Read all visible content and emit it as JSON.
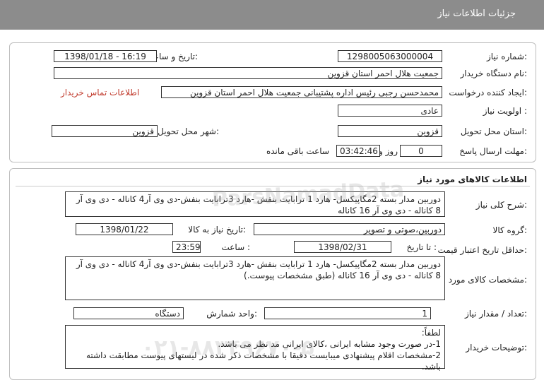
{
  "header": {
    "title": "جزئیات اطلاعات نیاز"
  },
  "general": {
    "need_number_label": "شماره نیاز:",
    "need_number": "1298005063000004",
    "announce_label": "تاریخ و ساعت اعلان عمومی:",
    "announce_value": "1398/01/18 - 16:19",
    "buyer_org_label": "نام دستگاه خریدار:",
    "buyer_org": "جمعیت هلال احمر استان قزوین",
    "requester_label": "ایجاد کننده درخواست:",
    "requester": "محمدحسن رجبی رئیس اداره پشتیبانی جمعیت هلال احمر استان قزوین",
    "contact_link": "اطلاعات تماس خریدار",
    "priority_label": "اولویت نیاز :",
    "priority": "عادی",
    "province_label": "استان محل تحویل:",
    "province": "قزوین",
    "city_label": "شهر محل تحویل:",
    "city": "قزوین",
    "deadline_label": "مهلت ارسال پاسخ:",
    "days": "0",
    "days_unit": "روز و",
    "time_left": "03:42:46",
    "time_left_suffix": "ساعت باقی مانده"
  },
  "goods": {
    "section_title": "اطلاعات کالاهای مورد نیاز",
    "summary_label": "شرح کلی نیاز:",
    "summary": "دوربین مدار بسته 2مگاپیکسل- هارد 1 ترابایت بنفش -هارد 3ترابایت بنفش-دی وی آر4 کاناله - دی وی آر 8 کاناله - دی وی آر 16 کاناله",
    "group_label": "گروه کالا:",
    "group": "دوربین،صوتی و تصویر",
    "need_date_label": "تاریخ نیاز به کالا:",
    "need_date": "1398/01/22",
    "validity_label": "حداقل تاریخ اعتبار قیمت:",
    "until_date_label": "تا تاریخ :",
    "until_date": "1398/02/31",
    "hour_label": "ساعت :",
    "hour": "23:59",
    "specs_label": "مشخصات کالای مورد نیاز:",
    "specs": "دوربین مدار بسته 2مگاپیکسل- هارد 1 ترابایت بنفش -هارد 3ترابایت بنفش-دی وی آر4 کاناله - دی وی آر 8 کاناله - دی وی آر 16 کاناله (طبق مشخصات پیوست.)",
    "qty_label": "تعداد / مقدار نیاز:",
    "qty": "1",
    "unit_label": "واحد شمارش:",
    "unit": "دستگاه",
    "notes_label": "توضیحات خریدار:",
    "notes": [
      "لطفاً:",
      "1-در صورت وجود مشابه ایرانی ،کالای ایرانی مد نظر می باشد.",
      "2-مشخصات اقلام پیشنهادی میبایست دقیقا با مشخصات ذکر شده در لیستهای پیوست مطابقت داشته باشد."
    ]
  },
  "watermark": {
    "line1": "ParsNamadData",
    "line2": "۰۲۱-۸۸۳۴۹۶۷۰-۵"
  }
}
